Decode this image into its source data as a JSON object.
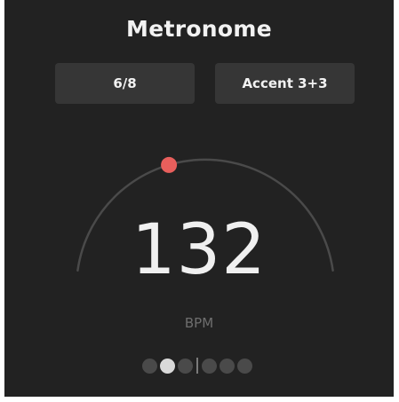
{
  "header": {
    "title": "Metronome"
  },
  "controls": {
    "time_signature": "6/8",
    "accent": "Accent 3+3"
  },
  "tempo": {
    "value": "132",
    "unit": "BPM",
    "dial_fraction": 0.4
  },
  "beats": {
    "count": 6,
    "active_index": 1,
    "group_split_after": 3
  },
  "colors": {
    "background": "#222222",
    "button": "#363636",
    "accent_dot": "#e85f5c",
    "arc": "#4a4a4a",
    "beat_active": "#d9d9d9",
    "beat_inactive": "#4a4a4a"
  }
}
